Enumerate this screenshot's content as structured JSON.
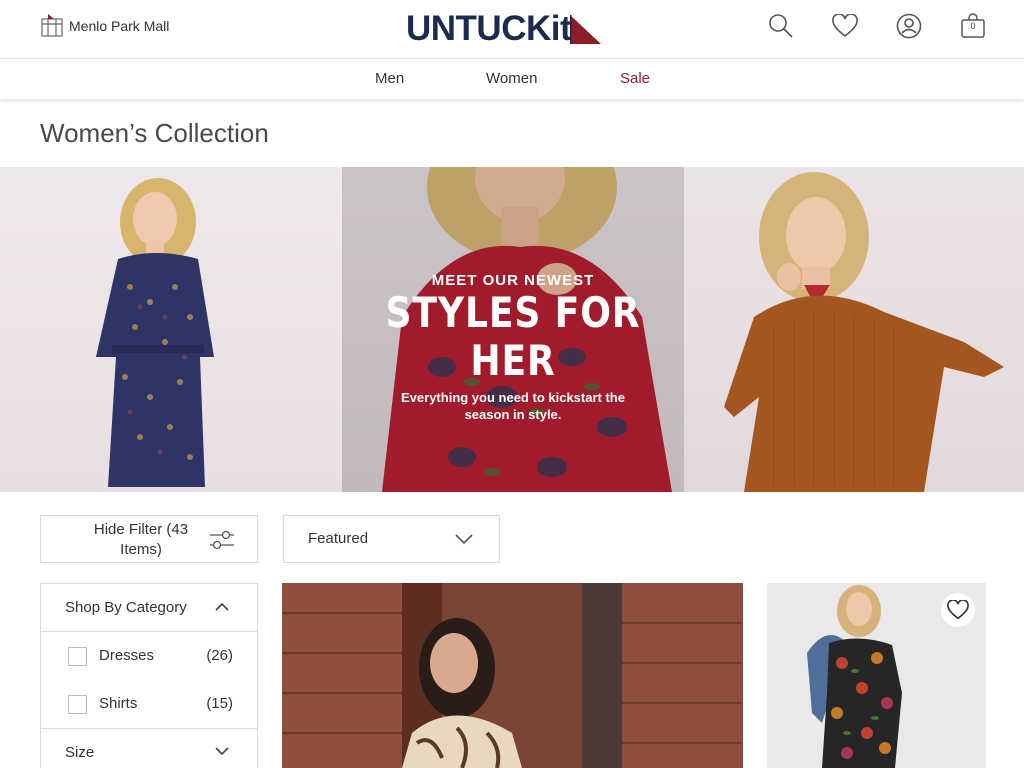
{
  "header": {
    "store_label": "Menlo Park Mall",
    "logo_text": "UNTUCKit",
    "bag_count": "0",
    "icons": [
      "search-icon",
      "heart-icon",
      "account-icon",
      "bag-icon"
    ]
  },
  "nav": {
    "items": [
      "Men",
      "Women",
      "Sale"
    ]
  },
  "page_title": "Women’s Collection",
  "hero": {
    "eyebrow": "MEET OUR NEWEST",
    "headline": "STYLES FOR HER",
    "subtext": "Everything you need to kickstart the season in style."
  },
  "controls": {
    "hide_filter_label": "Hide Filter (43 Items)",
    "sort_selected": "Featured"
  },
  "filters": {
    "category_heading": "Shop By Category",
    "category_items": [
      {
        "label": "Dresses",
        "count": "(26)"
      },
      {
        "label": "Shirts",
        "count": "(15)"
      }
    ],
    "size_heading": "Size"
  },
  "colors": {
    "brand_navy": "#1c2b4d",
    "brand_red": "#8c1d2a",
    "sale_red": "#8c1d2a",
    "border": "#d9d9d9"
  }
}
